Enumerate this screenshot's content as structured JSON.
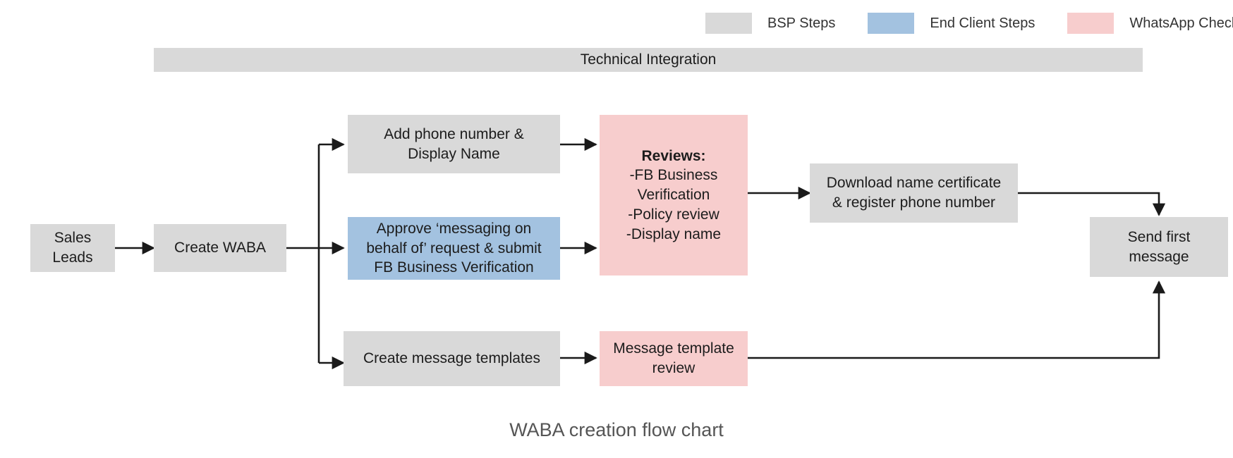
{
  "caption": "WABA creation flow chart",
  "colors": {
    "bsp": "#d9d9d9",
    "end_client": "#a3c2e0",
    "whatsapp": "#f7cdcd",
    "line": "#1a1a1a",
    "caption_text": "#555555"
  },
  "legend": {
    "items": [
      {
        "label": "BSP Steps",
        "swatch": "#d9d9d9",
        "key": "bsp"
      },
      {
        "label": "End Client Steps",
        "swatch": "#a3c2e0",
        "key": "end-client"
      },
      {
        "label": "WhatsApp Checks",
        "swatch": "#f7cdcd",
        "key": "whatsapp"
      }
    ]
  },
  "phase_bar": {
    "label": "Technical Integration"
  },
  "nodes": {
    "sales_leads": {
      "label": "Sales\nLeads",
      "category": "bsp"
    },
    "create_waba": {
      "label": "Create WABA",
      "category": "bsp"
    },
    "add_phone": {
      "label": "Add phone number &\nDisplay Name",
      "category": "bsp"
    },
    "approve_messaging": {
      "label": "Approve ‘messaging on\nbehalf of’ request & submit\nFB Business Verification",
      "category": "end-client"
    },
    "reviews_title": "Reviews:",
    "reviews_lines": [
      "-FB Business",
      "Verification",
      "-Policy review",
      "-Display name"
    ],
    "download_cert": {
      "label": "Download name certificate\n& register phone number",
      "category": "bsp"
    },
    "send_first": {
      "label": "Send first\nmessage",
      "category": "bsp"
    },
    "create_templates": {
      "label": "Create message templates",
      "category": "bsp"
    },
    "template_review": {
      "label": "Message template\nreview",
      "category": "whatsapp"
    }
  }
}
